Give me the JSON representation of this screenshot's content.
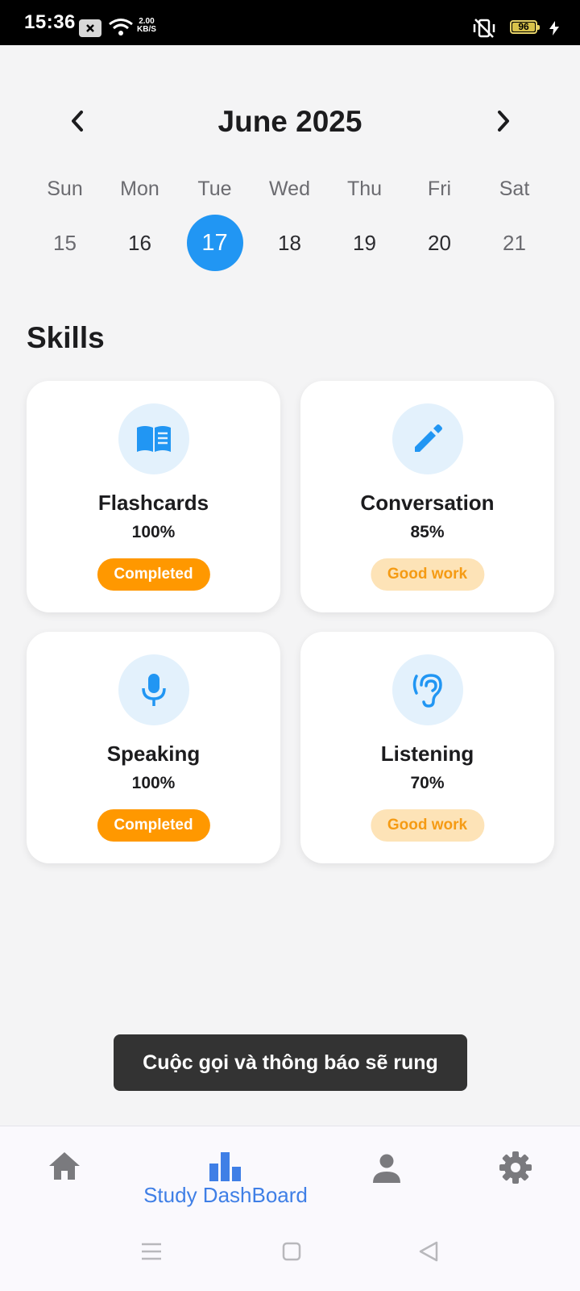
{
  "status_bar": {
    "time": "15:36",
    "net_speed_value": "2.00",
    "net_speed_unit": "KB/S",
    "battery": "96"
  },
  "calendar": {
    "month_title": "June 2025",
    "weekdays": [
      "Sun",
      "Mon",
      "Tue",
      "Wed",
      "Thu",
      "Fri",
      "Sat"
    ],
    "days": [
      "15",
      "16",
      "17",
      "18",
      "19",
      "20",
      "21"
    ],
    "selected_day": "17"
  },
  "skills": {
    "title": "Skills",
    "cards": [
      {
        "name": "Flashcards",
        "percent": "100%",
        "badge": "Completed",
        "icon": "book-icon"
      },
      {
        "name": "Conversation",
        "percent": "85%",
        "badge": "Good work",
        "icon": "pencil-icon"
      },
      {
        "name": "Speaking",
        "percent": "100%",
        "badge": "Completed",
        "icon": "microphone-icon"
      },
      {
        "name": "Listening",
        "percent": "70%",
        "badge": "Good work",
        "icon": "ear-icon"
      }
    ]
  },
  "toast": {
    "message": "Cuộc gọi và thông báo sẽ rung"
  },
  "bottom_nav": {
    "items": [
      {
        "icon": "home-icon"
      },
      {
        "icon": "bar-chart-icon",
        "label": "Study DashBoard"
      },
      {
        "icon": "person-icon"
      },
      {
        "icon": "settings-gear-icon"
      }
    ]
  },
  "colors": {
    "accent": "#2196f3",
    "completed": "#ff9800",
    "good_work_bg": "#fde3b7",
    "nav_active": "#3f7fe6"
  }
}
